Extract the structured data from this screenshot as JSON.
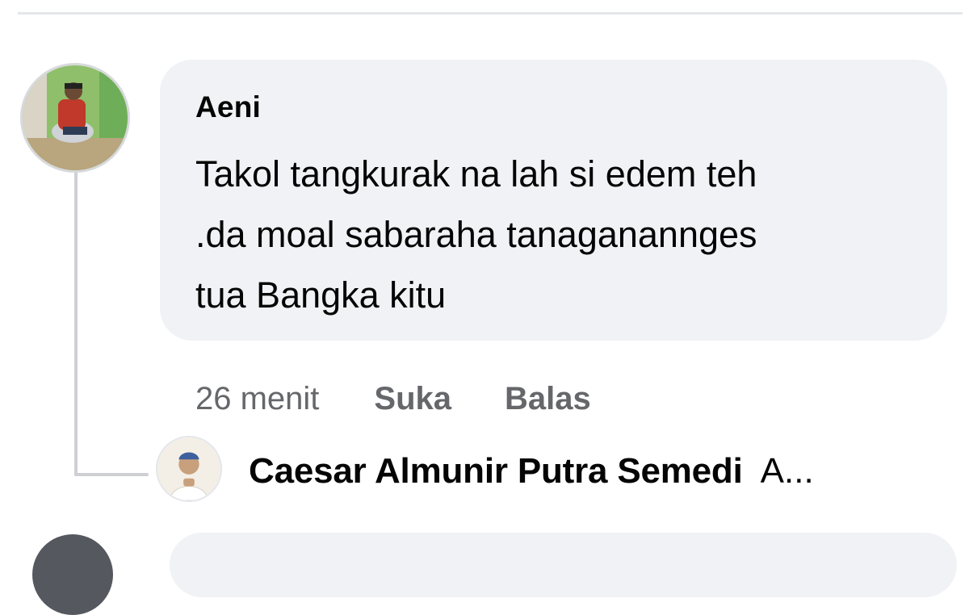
{
  "comment": {
    "author": "Aeni",
    "text_lines": [
      "Takol tangkurak na lah si edem teh",
      ".da moal sabaraha tanaganannges",
      "tua Bangka kitu"
    ],
    "time": "26 menit",
    "like_label": "Suka",
    "reply_label": "Balas"
  },
  "reply": {
    "author": "Caesar Almunir Putra Semedi",
    "preview": "A..."
  },
  "colors": {
    "bubble": "#f0f2f5",
    "meta_text": "#65676b",
    "thread_line": "#ced0d4",
    "text": "#050505"
  }
}
